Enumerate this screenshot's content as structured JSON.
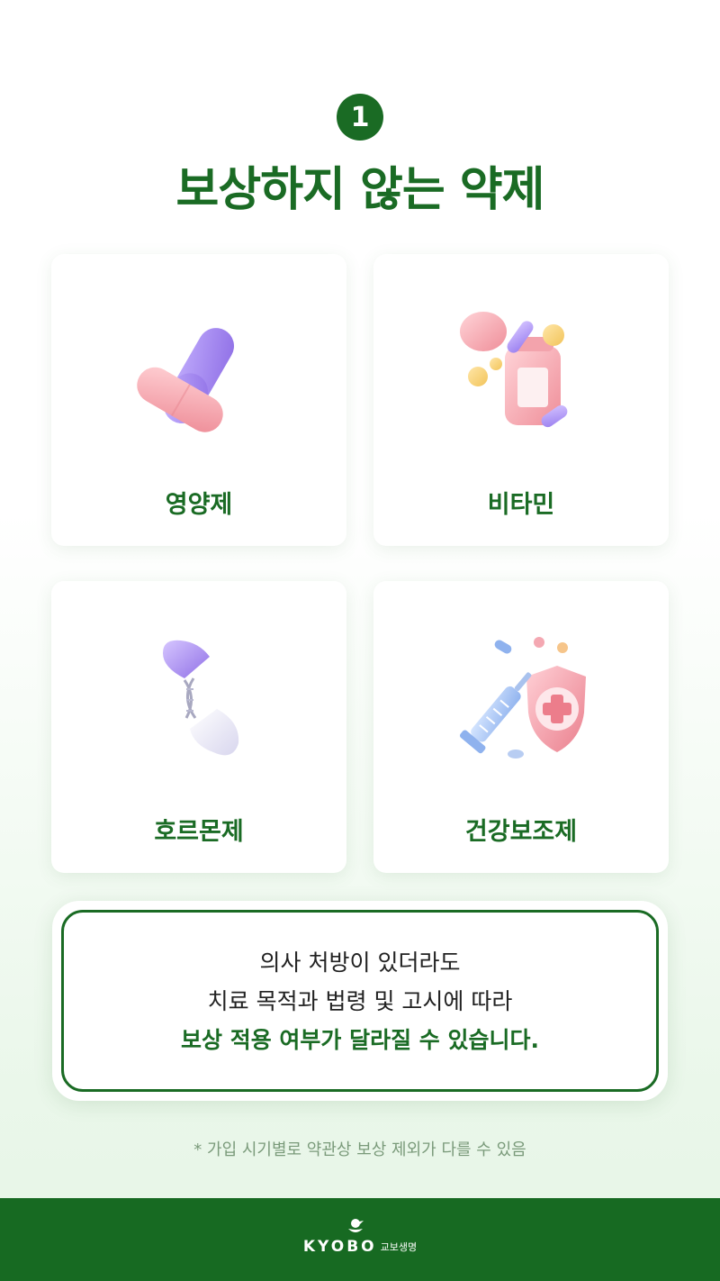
{
  "header": {
    "number": "1",
    "title": "보상하지 않는 약제"
  },
  "cards": [
    {
      "label": "영양제",
      "icon": "capsule-icon"
    },
    {
      "label": "비타민",
      "icon": "pill-bottle-icon"
    },
    {
      "label": "호르몬제",
      "icon": "dna-capsule-icon"
    },
    {
      "label": "건강보조제",
      "icon": "syringe-shield-icon"
    }
  ],
  "notice": {
    "line1": "의사 처방이 있더라도",
    "line2": "치료 목적과 법령 및 고시에 따라",
    "line3": "보상 적용 여부가 달라질 수 있습니다."
  },
  "footnote": "* 가입 시기별로 약관상 보상 제외가 다를 수 있음",
  "footer": {
    "brand": "KYOBO",
    "brand_kr": "교보생명"
  },
  "colors": {
    "brand_green": "#1a6b24",
    "pink": "#f4a5ad",
    "lavender": "#a98ef0"
  }
}
